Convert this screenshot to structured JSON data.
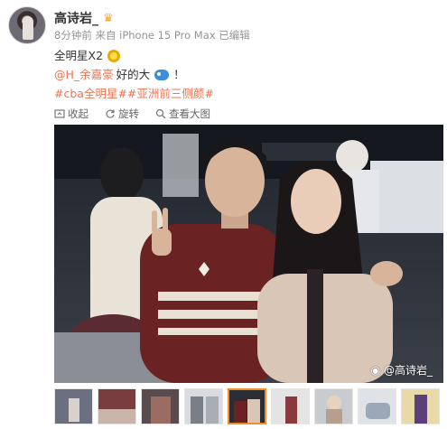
{
  "user": {
    "name": "高诗岩_",
    "meta": "8分钟前  来自 iPhone 15 Pro Max 已编辑"
  },
  "post": {
    "line1": "全明星X2",
    "mention": "@H_余嘉豪",
    "line2_text": " 好的大",
    "line2_end": "！",
    "hashtags": "#cba全明星##亚洲前三侧颜#"
  },
  "toolbar": {
    "collapse": "收起",
    "rotate": "旋转",
    "view_large": "查看大图"
  },
  "photo": {
    "watermark": "@高诗岩_"
  },
  "thumbnails": {
    "count": 9,
    "selected_index": 4
  }
}
